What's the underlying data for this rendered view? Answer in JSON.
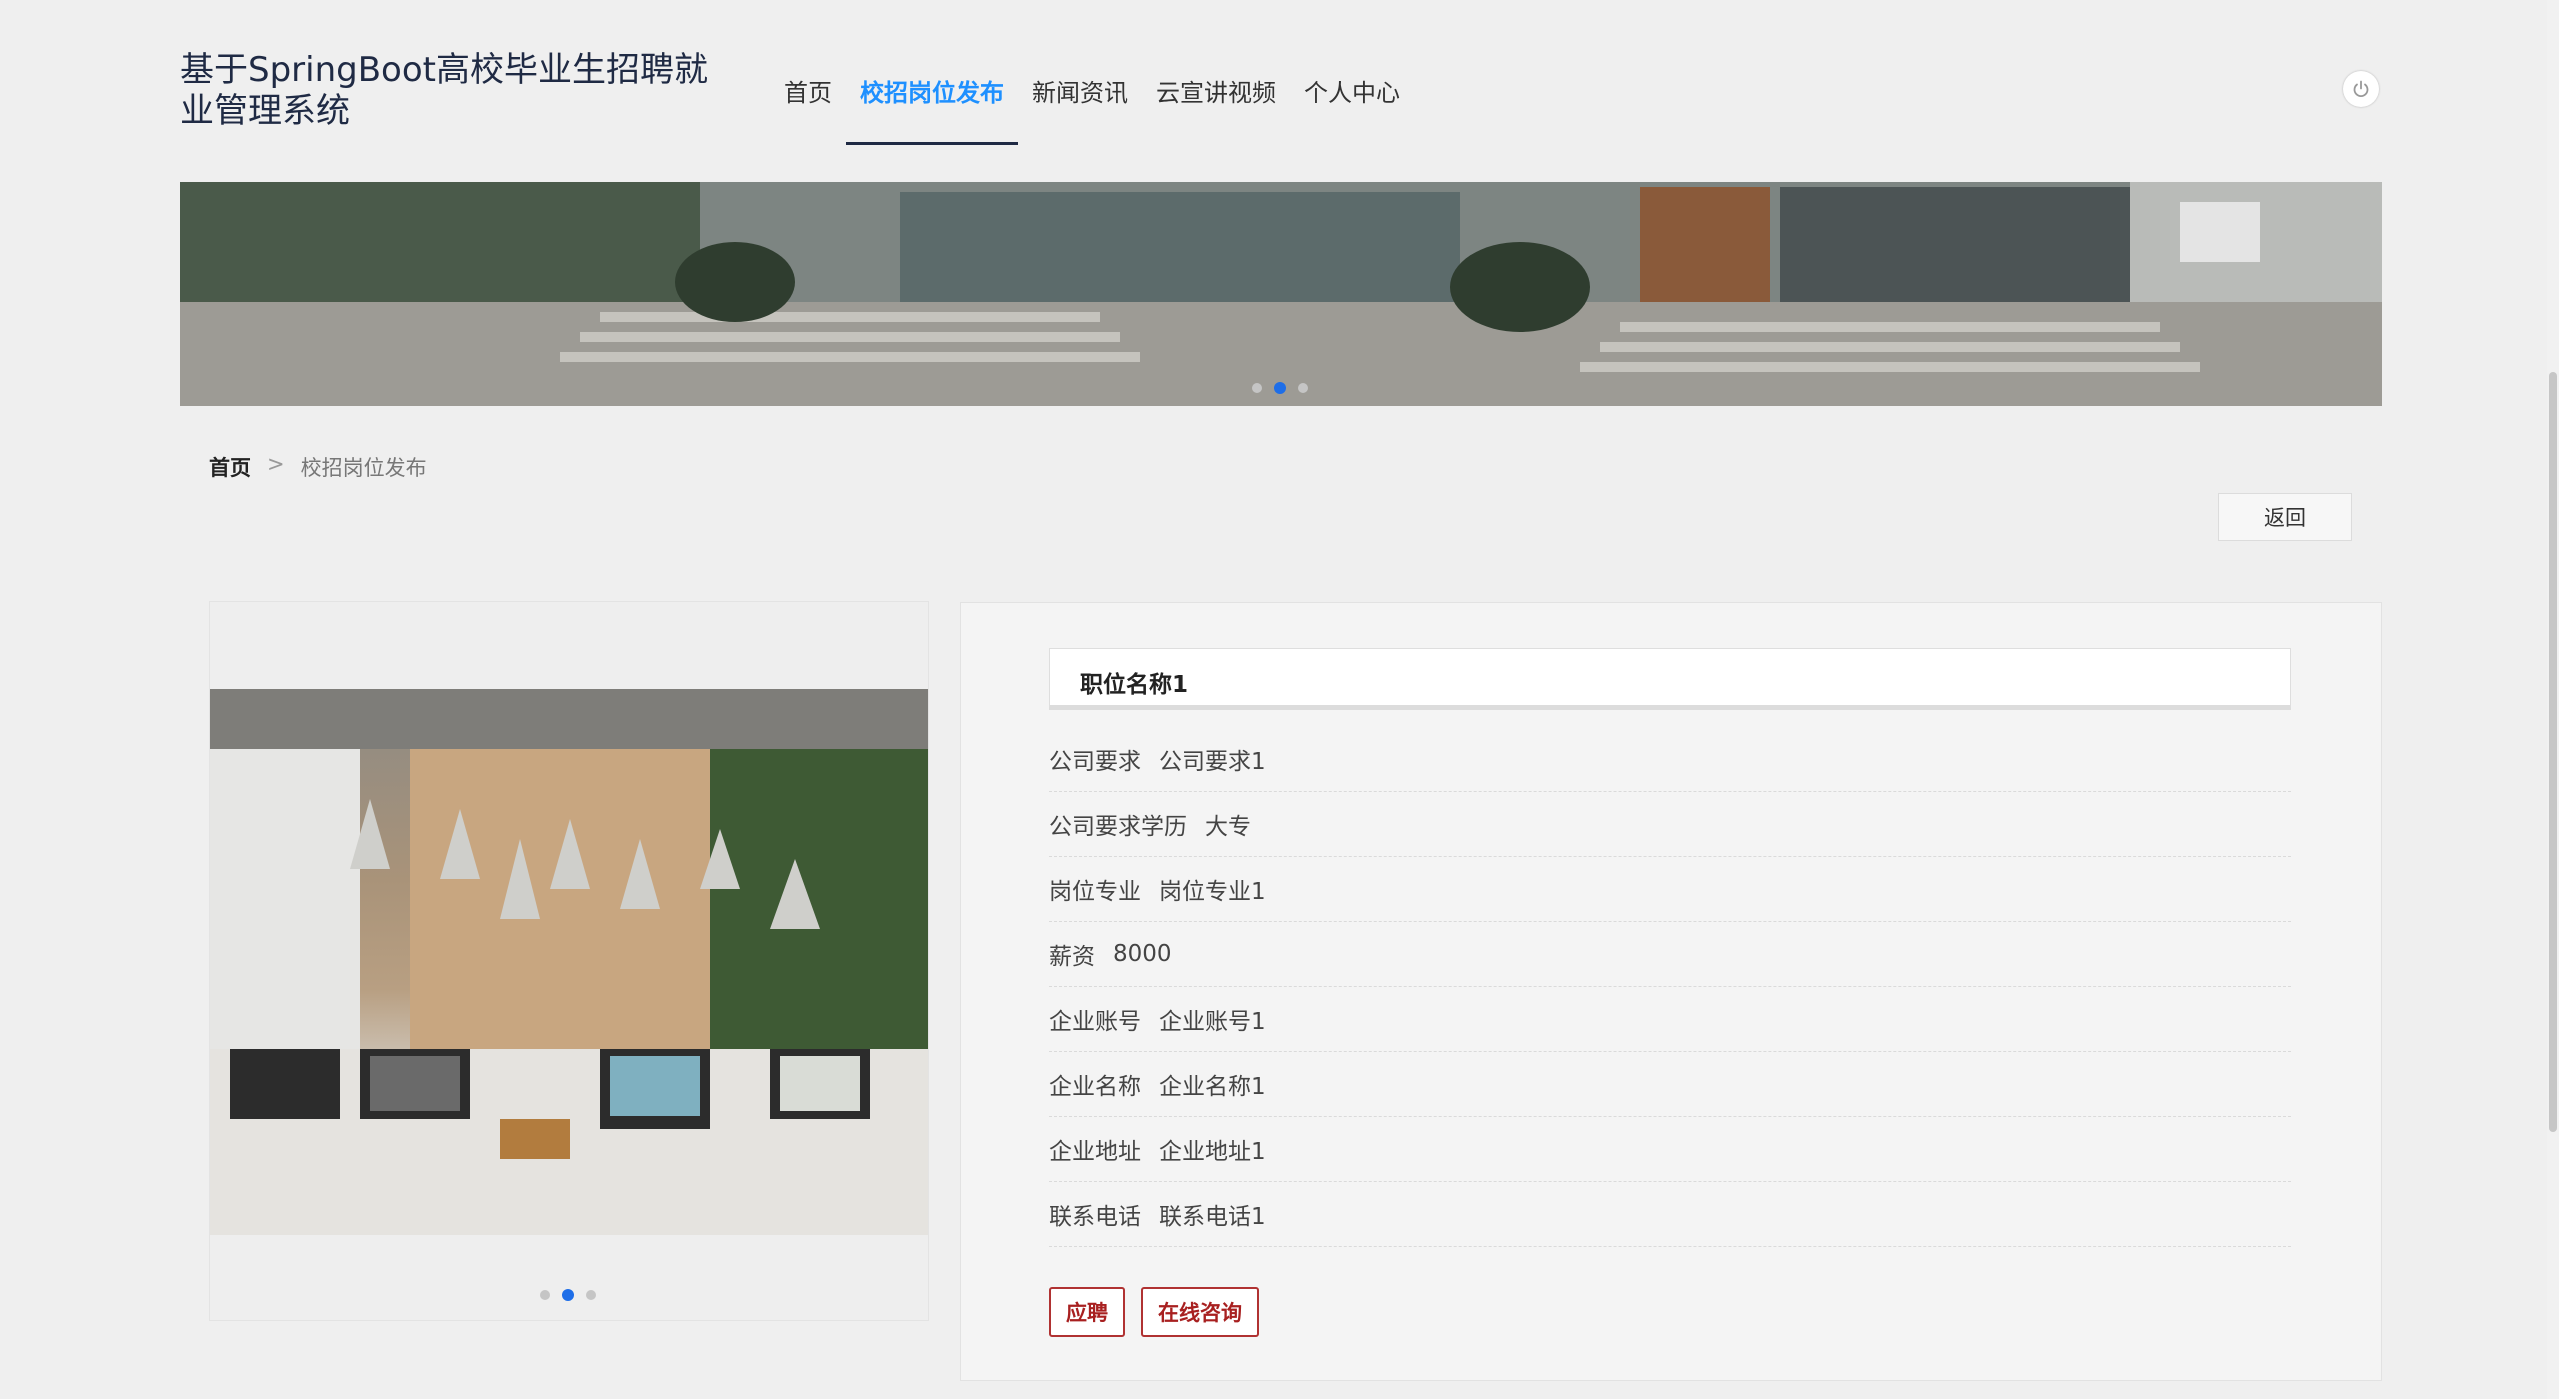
{
  "header": {
    "site_title": "基于SpringBoot高校毕业生招聘就业管理系统",
    "nav": [
      {
        "label": "首页"
      },
      {
        "label": "校招岗位发布",
        "active": true
      },
      {
        "label": "新闻资讯"
      },
      {
        "label": "云宣讲视频"
      },
      {
        "label": "个人中心"
      }
    ],
    "power_icon": "power-icon"
  },
  "banner": {
    "slide_count": 3,
    "active_slide": 2
  },
  "breadcrumb": {
    "home": "首页",
    "separator": ">",
    "current": "校招岗位发布"
  },
  "back_button": "返回",
  "gallery": {
    "slide_count": 3,
    "active_slide": 2
  },
  "job": {
    "title": "职位名称1",
    "fields": [
      {
        "label": "公司要求",
        "value": "公司要求1"
      },
      {
        "label": "公司要求学历",
        "value": "大专"
      },
      {
        "label": "岗位专业",
        "value": "岗位专业1"
      },
      {
        "label": "薪资",
        "value": "8000"
      },
      {
        "label": "企业账号",
        "value": "企业账号1"
      },
      {
        "label": "企业名称",
        "value": "企业名称1"
      },
      {
        "label": "企业地址",
        "value": "企业地址1"
      },
      {
        "label": "联系电话",
        "value": "联系电话1"
      }
    ],
    "actions": {
      "apply": "应聘",
      "consult": "在线咨询"
    }
  },
  "colors": {
    "accent": "#1e90ff",
    "title": "#1f2a44",
    "action_border": "#b03232"
  }
}
